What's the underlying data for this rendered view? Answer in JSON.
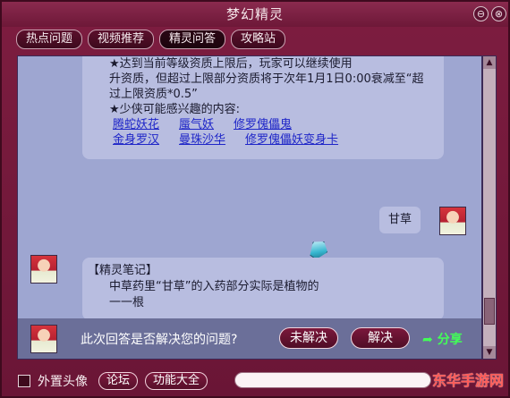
{
  "window": {
    "title": "梦幻精灵",
    "min_label": "⊖",
    "close_label": "⊗"
  },
  "tabs": [
    {
      "label": "热点问题",
      "active": false
    },
    {
      "label": "视频推荐",
      "active": false
    },
    {
      "label": "精灵问答",
      "active": true
    },
    {
      "label": "攻略站",
      "active": false
    }
  ],
  "chat": {
    "top_answer": {
      "lines": [
        "★达到当前等级资质上限后，玩家可以继续使用",
        "升资质，但超过上限部分资质将于次年1月1日0:00衰减至“超",
        "过上限资质*0.5”"
      ],
      "related_title": "★少侠可能感兴趣的内容:",
      "related_links": [
        [
          "腾蛇妖花",
          "蜃气妖",
          "修罗傀儡鬼"
        ],
        [
          "金身罗汉",
          "曼珠沙华",
          "修罗傀儡妖变身卡"
        ]
      ]
    },
    "user_message": "甘草",
    "bot_reply": {
      "title": "【精灵笔记】",
      "line1": "中草药里“甘草”的入药部分实际是植物的",
      "line2": "一一根"
    }
  },
  "feedback": {
    "question": "此次回答是否解决您的问题?",
    "unsolved": "未解决",
    "solved": "解决",
    "share": "分享"
  },
  "bottom": {
    "checkbox_label": "外置头像",
    "forum": "论坛",
    "features": "功能大全",
    "input_value": "",
    "input_placeholder": ""
  },
  "watermark": "东华手游网"
}
